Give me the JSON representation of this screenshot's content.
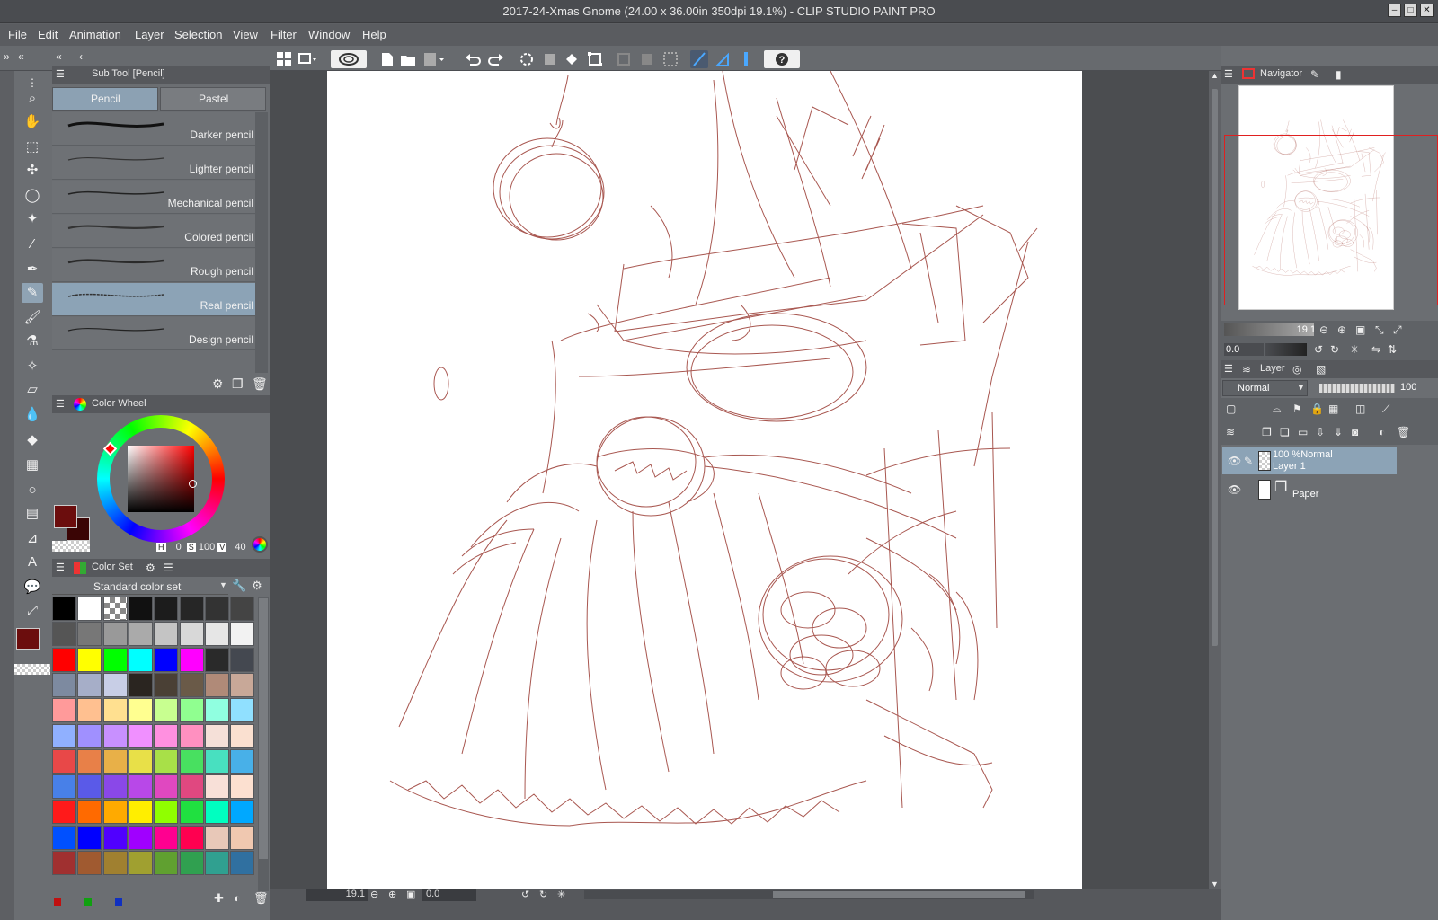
{
  "window": {
    "title": "2017-24-Xmas Gnome (24.00 x 36.00in 350dpi 19.1%)  - CLIP STUDIO PAINT PRO",
    "controls": [
      "minimize",
      "maximize",
      "close"
    ]
  },
  "menu": [
    "File",
    "Edit",
    "Animation",
    "Layer",
    "Selection",
    "View",
    "Filter",
    "Window",
    "Help"
  ],
  "subtool_panel": {
    "header": "Sub Tool [Pencil]",
    "tabs": [
      {
        "label": "Pencil",
        "selected": true
      },
      {
        "label": "Pastel",
        "selected": false
      }
    ],
    "brushes": [
      {
        "name": "Darker pencil",
        "selected": false
      },
      {
        "name": "Lighter pencil",
        "selected": false
      },
      {
        "name": "Mechanical pencil",
        "selected": false
      },
      {
        "name": "Colored pencil",
        "selected": false
      },
      {
        "name": "Rough pencil",
        "selected": false
      },
      {
        "name": "Real pencil",
        "selected": true
      },
      {
        "name": "Design pencil",
        "selected": false
      }
    ]
  },
  "color_wheel": {
    "header": "Color Wheel",
    "h_label": "H",
    "h_value": "0",
    "s_label": "S",
    "s_value": "100",
    "v_label": "V",
    "v_value": "40",
    "main_color": "#6b0d0d",
    "sub_color": "#3a0505"
  },
  "color_set": {
    "header": "Color Set",
    "selected_set": "Standard color set",
    "swatches": [
      [
        "#000000",
        "#ffffff",
        "checker",
        "#111111",
        "#1c1c1c",
        "#262626",
        "#333333",
        "#444444"
      ],
      [
        "#555555",
        "#777777",
        "#999999",
        "#aaaaaa",
        "#c4c4c4",
        "#d8d8d8",
        "#e6e6e6",
        "#f2f2f2"
      ],
      [
        "#ff0000",
        "#ffff00",
        "#00ff00",
        "#00ffff",
        "#0000ff",
        "#ff00ff",
        "#2a2a2a",
        "#444850"
      ],
      [
        "#7d8aa0",
        "#a6aec8",
        "#c8cee6",
        "#2a2520",
        "#4a4035",
        "#6a5a48",
        "#b08a78",
        "#c8a898"
      ],
      [
        "#ff9a9a",
        "#ffc090",
        "#ffe090",
        "#ffff90",
        "#c8ff90",
        "#90ff90",
        "#90ffe0",
        "#90e0ff"
      ],
      [
        "#90b0ff",
        "#a090ff",
        "#c890ff",
        "#f090ff",
        "#ff90e0",
        "#ff90c0",
        "#f5e0d8",
        "#fae0d0"
      ],
      [
        "#e84848",
        "#e88048",
        "#e8b048",
        "#e8e048",
        "#a8e048",
        "#48e060",
        "#48e0c0",
        "#48b0e8"
      ],
      [
        "#4880e8",
        "#5a5ae8",
        "#8a48e8",
        "#b848e8",
        "#e048c0",
        "#e04880",
        "#f8e0d8",
        "#fce0d0"
      ],
      [
        "#ff1a1a",
        "#ff6a00",
        "#ffaa00",
        "#ffee00",
        "#90ff00",
        "#20e040",
        "#00ffc0",
        "#00a8ff"
      ],
      [
        "#0050ff",
        "#0000ff",
        "#5000ff",
        "#a000ff",
        "#ff0090",
        "#ff0050",
        "#e8c8b8",
        "#f0c8b0"
      ],
      [
        "#a03030",
        "#a05a30",
        "#a08030",
        "#a0a030",
        "#60a030",
        "#30a050",
        "#30a090",
        "#3070a0"
      ]
    ]
  },
  "navigator": {
    "header": "Navigator",
    "zoom": "19.1",
    "rotation": "0.0"
  },
  "layer_panel": {
    "header": "Layer",
    "blend_mode": "Normal",
    "opacity": "100",
    "layers": [
      {
        "opacity_mode": "100 %Normal",
        "name": "Layer 1",
        "selected": true
      },
      {
        "opacity_mode": "",
        "name": "Paper",
        "selected": false
      }
    ]
  },
  "status": {
    "zoom": "19.1",
    "rotation": "0.0"
  },
  "colors": {
    "sketch_stroke": "#9a3a32",
    "selection_highlight": "#8ca3b6",
    "navigator_frame": "#e02020"
  }
}
